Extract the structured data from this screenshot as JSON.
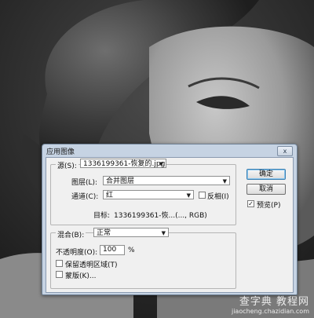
{
  "dialog": {
    "title": "应用图像",
    "close_symbol": "x",
    "source_label": "源(S):",
    "source_value": "1336199361-恢复的.jpg",
    "layer_label": "图层(L):",
    "layer_value": "合并图层",
    "channel_label": "通道(C):",
    "channel_value": "红",
    "invert_label": "反相(I)",
    "invert_checked": false,
    "target_label": "目标:",
    "target_value": "1336199361-恢...(..., RGB)",
    "blending_label": "混合(B):",
    "blending_value": "正常",
    "opacity_label": "不透明度(O):",
    "opacity_value": "100",
    "opacity_unit": "%",
    "preserve_transparency_label": "保留透明区域(T)",
    "preserve_transparency_checked": false,
    "mask_label": "蒙版(K)...",
    "mask_checked": false,
    "ok_label": "确定",
    "cancel_label": "取消",
    "preview_label": "预览(P)",
    "preview_checked": true
  },
  "watermark": {
    "top": "查字典 教程网",
    "url": "jiaocheng.chazidian.com"
  }
}
